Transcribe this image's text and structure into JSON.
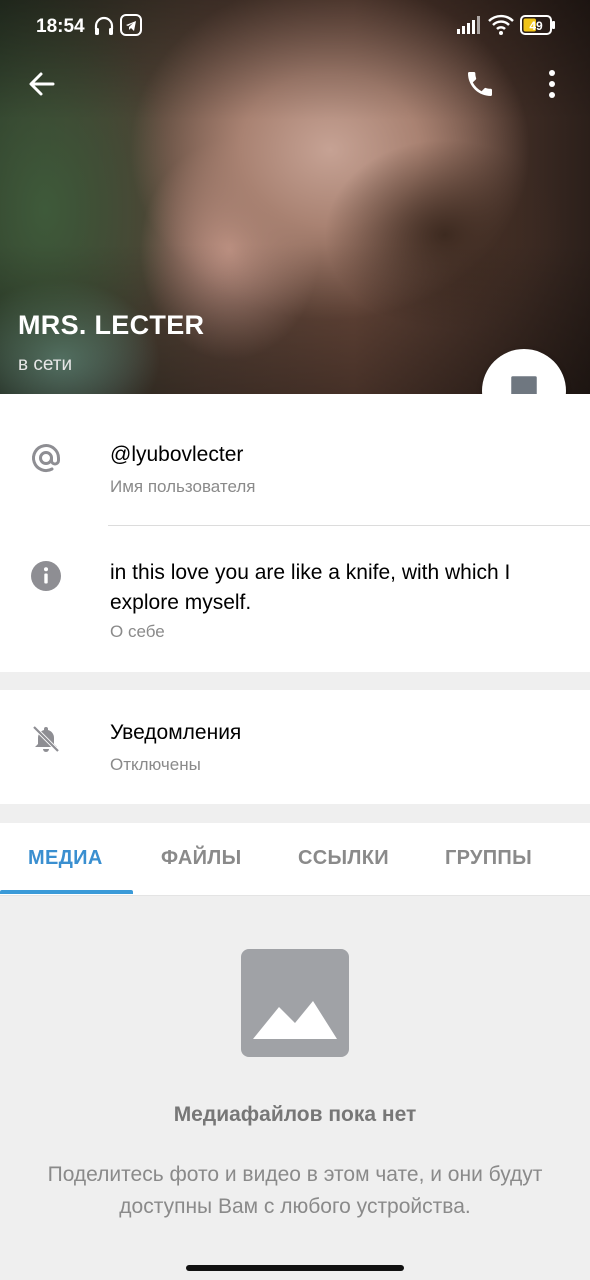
{
  "statusbar": {
    "time": "18:54",
    "battery": "49",
    "icons": [
      "headphones-icon",
      "telegram-icon",
      "signal-icon",
      "wifi-icon",
      "battery-icon"
    ]
  },
  "toolbar": {
    "back_icon": "back-arrow-icon",
    "call_icon": "phone-icon",
    "menu_icon": "more-vertical-icon"
  },
  "profile": {
    "name": "MRS. LECTER",
    "status": "в сети",
    "fab_icon": "message-icon"
  },
  "info": {
    "username": "@lyubovlecter",
    "username_label": "Имя пользователя",
    "bio_line1": "in this love you are like a knife, with which I",
    "bio_line2": "explore myself.",
    "bio_label": "О себе"
  },
  "notifications": {
    "title": "Уведомления",
    "value": "Отключены"
  },
  "tabs": [
    {
      "label": "МЕДИА",
      "active": true
    },
    {
      "label": "ФАЙЛЫ",
      "active": false
    },
    {
      "label": "ССЫЛКИ",
      "active": false
    },
    {
      "label": "ГРУППЫ",
      "active": false
    }
  ],
  "empty": {
    "title": "Медиафайлов пока нет",
    "desc_line1": "Поделитесь фото и видео в этом чате, и они будут",
    "desc_line2": "доступны Вам с любого устройства."
  },
  "colors": {
    "accent": "#3a8fd0",
    "icon_gray": "#8e8e93",
    "placeholder_gray": "#a0a2a6"
  }
}
